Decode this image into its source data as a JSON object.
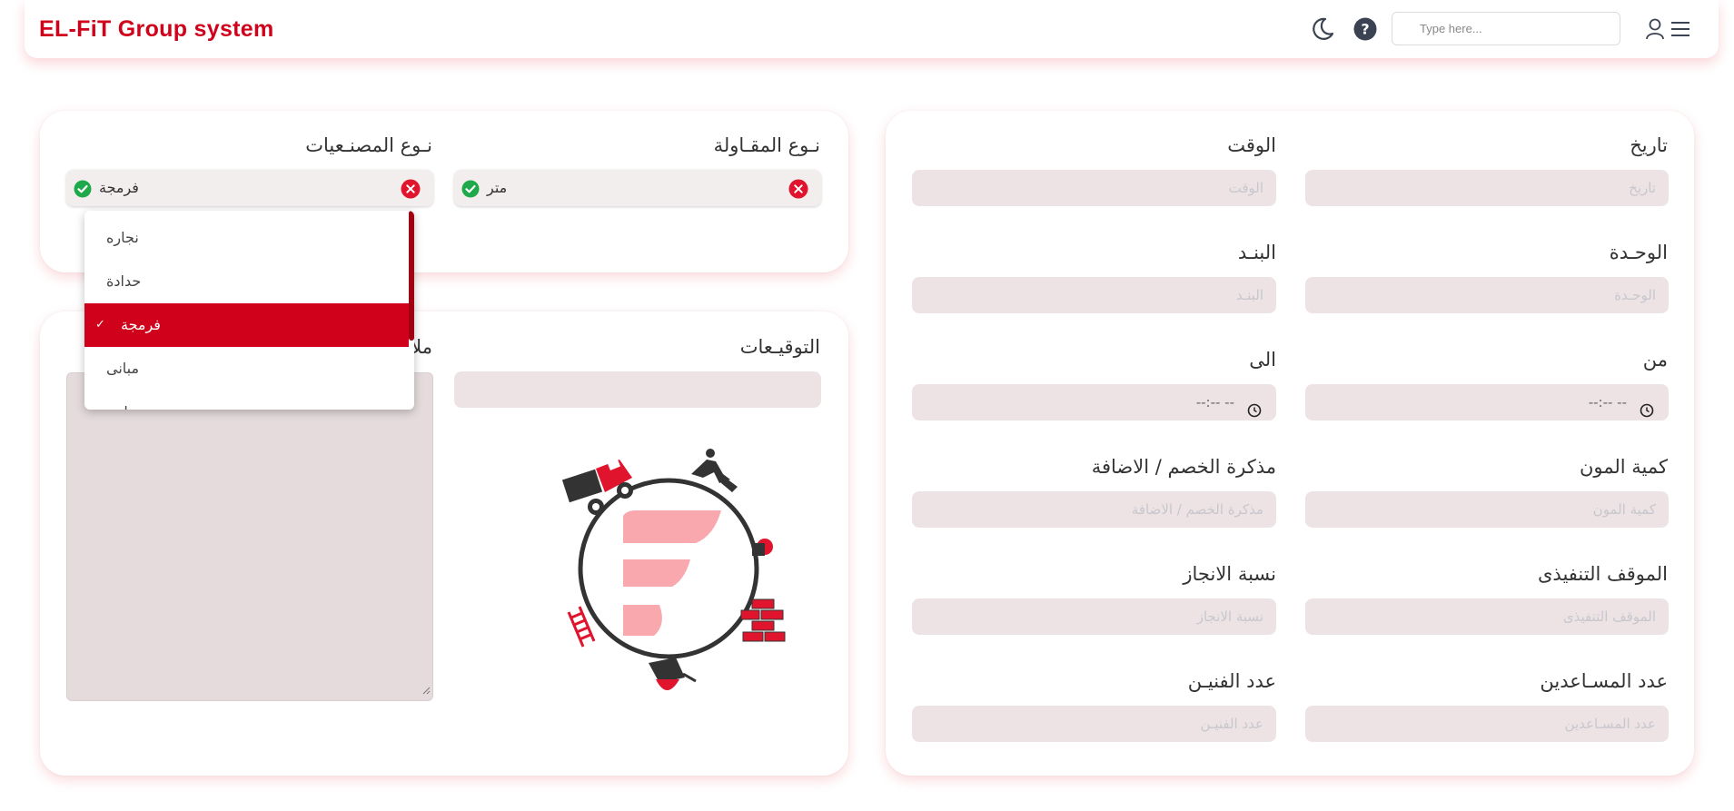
{
  "header": {
    "brand": "EL-FiT Group system",
    "search_placeholder": "Type here..."
  },
  "left_card": {
    "contract_type": {
      "label": "نـوع المقـاولة",
      "selected": "متر"
    },
    "works_type": {
      "label": "نـوع المصنـعيات",
      "selected": "فرمجة",
      "options": [
        "نجاره",
        "حدادة",
        "فرمجة",
        "مبانى",
        "بياض"
      ],
      "selected_index": 2
    }
  },
  "bottom_card": {
    "signatures_label": "التوقيـعات",
    "notes_label": "ملاحظات"
  },
  "right_card": {
    "fields": [
      {
        "label": "تاريخ",
        "placeholder": "تاريخ"
      },
      {
        "label": "الوقت",
        "placeholder": "الوقت"
      },
      {
        "label": "الوحـدة",
        "placeholder": "الوحـدة"
      },
      {
        "label": "البنـد",
        "placeholder": "البنـد"
      },
      {
        "label": "من",
        "value": "--:-- --"
      },
      {
        "label": "الى",
        "value": "--:-- --"
      },
      {
        "label": "كمية المون",
        "placeholder": "كمية المون"
      },
      {
        "label": "مذكرة الخصم / الاضافة",
        "placeholder": "مذكرة الخصم / الاضافة"
      },
      {
        "label": "الموقف التنفيذى",
        "placeholder": "الموقف التنفيذى"
      },
      {
        "label": "نسبة الانجاز",
        "placeholder": "نسبة الانجاز"
      },
      {
        "label": "عدد المسـاعدين",
        "placeholder": "عدد المسـاعدين"
      },
      {
        "label": "عدد الفنيـن",
        "placeholder": "عدد الفنيـن"
      }
    ]
  },
  "colors": {
    "brand": "#d0021b",
    "field_bg": "#ede3e5",
    "shadow": "#e21428"
  }
}
